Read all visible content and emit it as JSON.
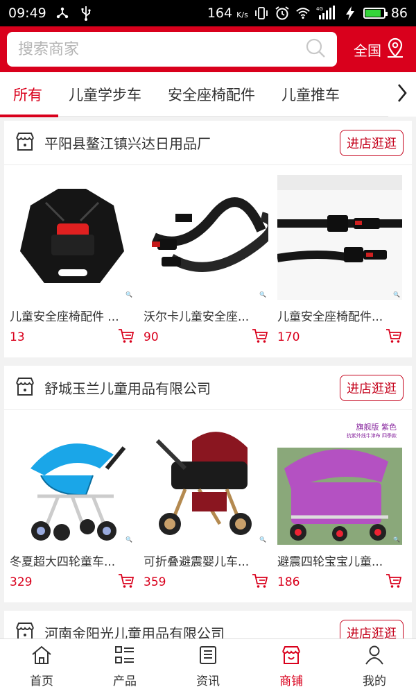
{
  "status_bar": {
    "time": "09:49",
    "speed": "164",
    "speed_unit": "K/s",
    "network": "4G",
    "battery": "86",
    "battery_level": 0.86
  },
  "search": {
    "placeholder": "搜索商家",
    "region_label": "全国"
  },
  "tabs": [
    {
      "label": "所有",
      "active": true
    },
    {
      "label": "儿童学步车"
    },
    {
      "label": "安全座椅配件"
    },
    {
      "label": "儿童推车"
    }
  ],
  "shops": [
    {
      "name": "平阳县鳌江镇兴达日用品厂",
      "visit_label": "进店逛逛",
      "products": [
        {
          "title": "儿童安全座椅配件 ...",
          "price": "13"
        },
        {
          "title": "沃尔卡儿童安全座...",
          "price": "90"
        },
        {
          "title": "儿童安全座椅配件...",
          "price": "170"
        }
      ]
    },
    {
      "name": "舒城玉兰儿童用品有限公司",
      "visit_label": "进店逛逛",
      "products": [
        {
          "title": "冬夏超大四轮童车...",
          "price": "329"
        },
        {
          "title": "可折叠避震婴儿车...",
          "price": "359"
        },
        {
          "title": "避震四轮宝宝儿童...",
          "price": "186",
          "badge_1": "旗舰版 紫色",
          "badge_2": "抗紫外线牛津布 四季款"
        }
      ]
    },
    {
      "name": "河南金阳光儿童用品有限公司",
      "visit_label": "进店逛逛",
      "products": []
    }
  ],
  "bottom_nav": [
    {
      "label": "首页",
      "icon": "home-icon"
    },
    {
      "label": "产品",
      "icon": "list-icon"
    },
    {
      "label": "资讯",
      "icon": "news-icon"
    },
    {
      "label": "商铺",
      "icon": "store-icon",
      "active": true
    },
    {
      "label": "我的",
      "icon": "user-icon"
    }
  ],
  "colors": {
    "brand": "#d9001c",
    "price": "#d9001c",
    "background": "#f2f2f2"
  }
}
